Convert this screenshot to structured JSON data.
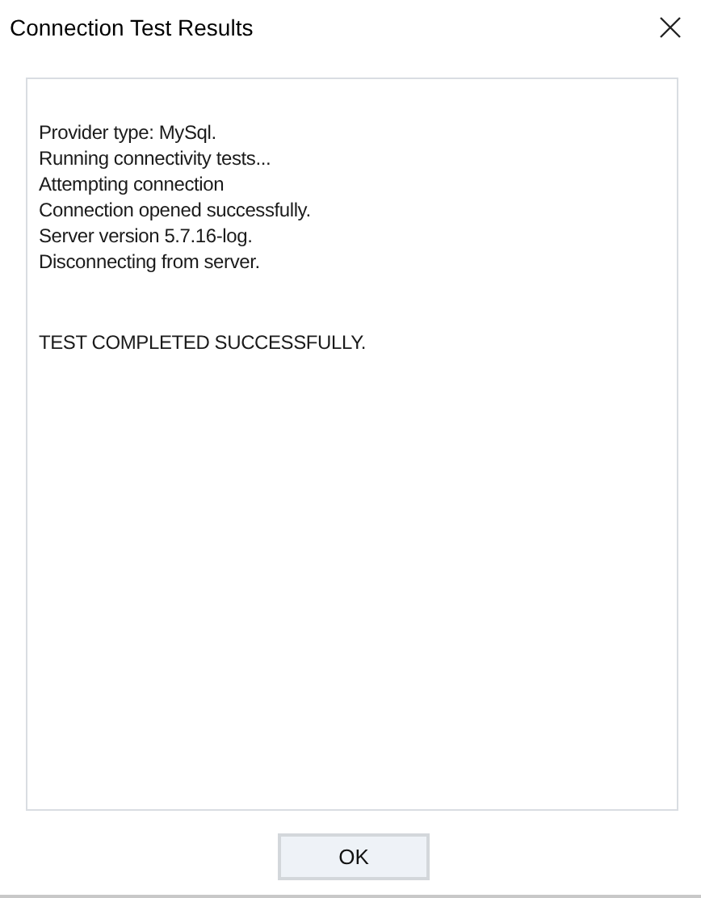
{
  "window": {
    "title": "Connection Test Results"
  },
  "output": {
    "lines": [
      "Provider type: MySql.",
      "Running connectivity tests...",
      "Attempting connection",
      "Connection opened successfully.",
      "Server version 5.7.16-log.",
      "Disconnecting from server."
    ],
    "result": "TEST COMPLETED SUCCESSFULLY."
  },
  "buttons": [
    "OK"
  ]
}
